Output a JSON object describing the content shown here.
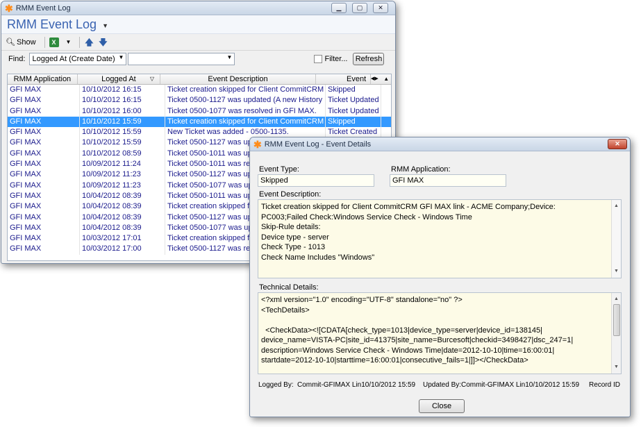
{
  "main": {
    "window_title": "RMM Event Log",
    "header_title": "RMM Event Log",
    "toolbar": {
      "show_label": "Show"
    },
    "find": {
      "label": "Find:",
      "field_value": "Logged At (Create Date)",
      "search_value": "",
      "filter_label": "Filter...",
      "refresh_label": "Refresh"
    },
    "columns": [
      "RMM Application",
      "Logged At",
      "Event Description",
      "Event"
    ],
    "rows": [
      {
        "app": "GFI MAX",
        "at": "10/10/2012 16:15",
        "desc": "Ticket creation skipped for Client CommitCRM",
        "event": "Skipped"
      },
      {
        "app": "GFI MAX",
        "at": "10/10/2012 16:15",
        "desc": "Ticket 0500-1127 was updated (A new History",
        "event": "Ticket Updated"
      },
      {
        "app": "GFI MAX",
        "at": "10/10/2012 16:00",
        "desc": "Ticket 0500-1077 was resolved in GFI MAX.",
        "event": "Ticket Updated"
      },
      {
        "app": "GFI MAX",
        "at": "10/10/2012 15:59",
        "desc": "Ticket creation skipped for Client CommitCRM",
        "event": "Skipped"
      },
      {
        "app": "GFI MAX",
        "at": "10/10/2012 15:59",
        "desc": "New Ticket was added - 0500-1135.",
        "event": "Ticket Created"
      },
      {
        "app": "GFI MAX",
        "at": "10/10/2012 15:59",
        "desc": "Ticket 0500-1127 was up",
        "event": ""
      },
      {
        "app": "GFI MAX",
        "at": "10/10/2012 08:59",
        "desc": "Ticket 0500-1011 was up",
        "event": ""
      },
      {
        "app": "GFI MAX",
        "at": "10/09/2012 11:24",
        "desc": "Ticket 0500-1011 was re",
        "event": ""
      },
      {
        "app": "GFI MAX",
        "at": "10/09/2012 11:23",
        "desc": "Ticket 0500-1127 was up",
        "event": ""
      },
      {
        "app": "GFI MAX",
        "at": "10/09/2012 11:23",
        "desc": "Ticket 0500-1077 was up",
        "event": ""
      },
      {
        "app": "GFI MAX",
        "at": "10/04/2012 08:39",
        "desc": "Ticket 0500-1011 was up",
        "event": ""
      },
      {
        "app": "GFI MAX",
        "at": "10/04/2012 08:39",
        "desc": "Ticket creation skipped fo",
        "event": ""
      },
      {
        "app": "GFI MAX",
        "at": "10/04/2012 08:39",
        "desc": "Ticket 0500-1127 was up",
        "event": ""
      },
      {
        "app": "GFI MAX",
        "at": "10/04/2012 08:39",
        "desc": "Ticket 0500-1077 was up",
        "event": ""
      },
      {
        "app": "GFI MAX",
        "at": "10/03/2012 17:01",
        "desc": "Ticket creation skipped fo",
        "event": ""
      },
      {
        "app": "GFI MAX",
        "at": "10/03/2012 17:00",
        "desc": "Ticket 0500-1127 was re",
        "event": ""
      }
    ],
    "selected_row": 3
  },
  "details": {
    "window_title": "RMM Event Log - Event Details",
    "event_type_label": "Event Type:",
    "event_type_value": "Skipped",
    "rmm_app_label": "RMM Application:",
    "rmm_app_value": "GFI MAX",
    "event_desc_label": "Event Description:",
    "event_desc_lines": [
      "Ticket creation skipped for Client CommitCRM GFI MAX link - ACME Company;Device:",
      "PC003;Failed Check:Windows Service Check - Windows Time",
      "Skip-Rule details:",
      "Device type - server",
      "Check Type - 1013",
      "Check Name Includes \"Windows\""
    ],
    "tech_label": "Technical Details:",
    "tech_lines": [
      "<?xml version=\"1.0\" encoding=\"UTF-8\" standalone=\"no\" ?>",
      "<TechDetails>",
      "",
      "  <CheckData><![CDATA[check_type=1013|device_type=server|device_id=138145|",
      "device_name=VISTA-PC|site_id=41375|site_name=Burcesoft|checkid=3498427|dsc_247=1|",
      "description=Windows Service Check - Windows Time|date=2012-10-10|time=16:00:01|",
      "startdate=2012-10-10|starttime=16:00:01|consecutive_fails=1|]]></CheckData>"
    ],
    "logged_by_label": "Logged By:",
    "logged_by_value": "Commit-GFIMAX Lin10/10/2012  15:59",
    "updated_by_label": "Updated By:",
    "updated_by_value": "Commit-GFIMAX Lin10/10/2012  15:59",
    "record_id_label": "Record ID",
    "close_label": "Close"
  }
}
